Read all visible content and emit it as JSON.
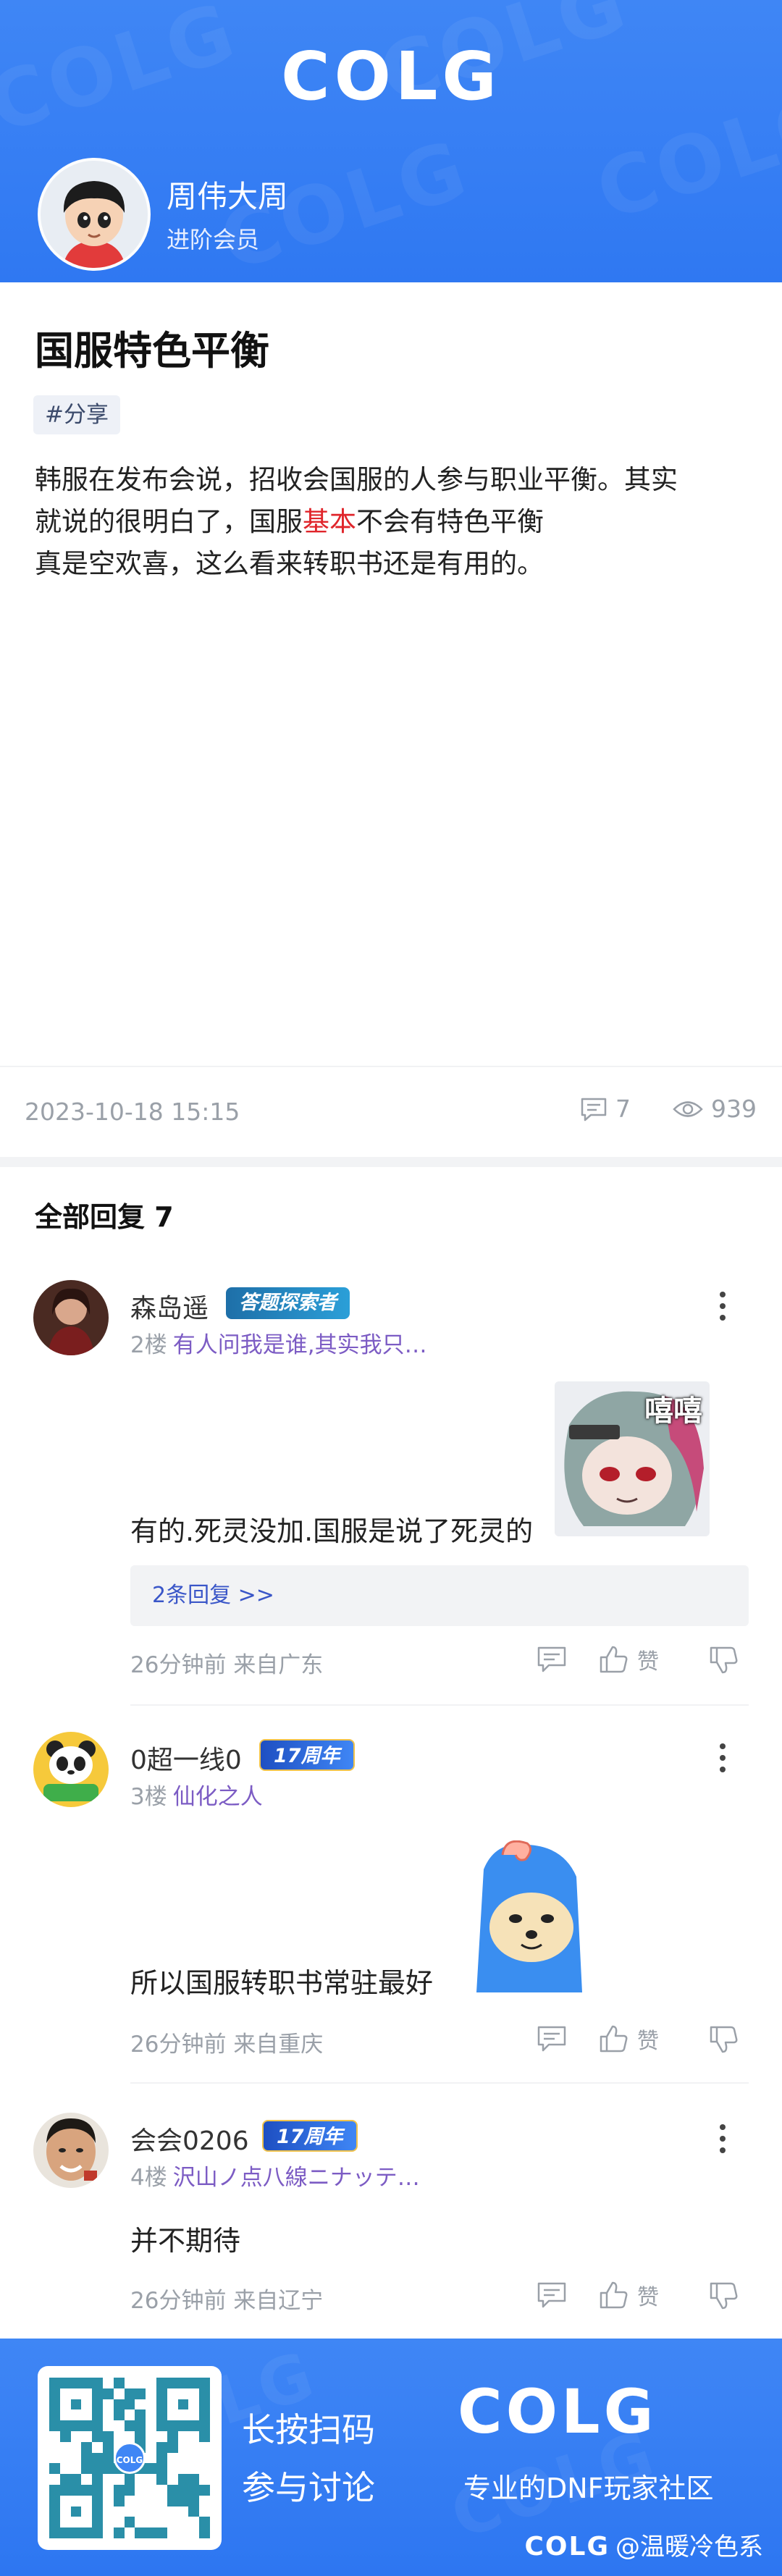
{
  "header": {
    "logo_text": "COLG",
    "username": "周伟大周",
    "user_level": "进阶会员"
  },
  "post": {
    "title": "国服特色平衡",
    "tag": "#分享",
    "body_line1": "韩服在发布会说，招收会国服的人参与职业平衡。其实",
    "body_line2_before": "就说的很明白了，国服",
    "body_line2_highlight": "基本",
    "body_line2_after": "不会有特色平衡",
    "body_line3": "真是空欢喜，这么看来转职书还是有用的。",
    "highlight_color": "#e0252b",
    "date": "2023-10-18 15:15",
    "comment_count": "7",
    "view_count": "939"
  },
  "replies": {
    "header": "全部回复 7",
    "items": [
      {
        "name": "森岛遥",
        "badge": "答题探索者",
        "floor": "2楼",
        "quote": "有人问我是谁,其实我只…",
        "text": "有的.死灵没加.国服是说了死灵的",
        "sticker_text": "嘻嘻",
        "sub_replies": "2条回复 >>",
        "time": "26分钟前",
        "location": "来自广东",
        "like_label": "赞"
      },
      {
        "name": "0超一线0",
        "badge": "17周年",
        "floor": "3楼",
        "quote": "仙化之人",
        "text": "所以国服转职书常驻最好",
        "time": "26分钟前",
        "location": "来自重庆",
        "like_label": "赞"
      },
      {
        "name": "会会0206",
        "badge": "17周年",
        "floor": "4楼",
        "quote": "沢山ノ点八線ニナッテ…",
        "text": "并不期待",
        "time": "26分钟前",
        "location": "来自辽宁",
        "like_label": "赞"
      }
    ]
  },
  "footer": {
    "qr_logo": "COLG",
    "cta_line1": "长按扫码",
    "cta_line2": "参与讨论",
    "logo_text": "COLG",
    "slogan": "专业的DNF玩家社区",
    "credit_logo": "COLG",
    "credit_text": "@温暖冷色系"
  },
  "colors": {
    "brand_blue": "#3f86f5",
    "quote_purple": "#7c5cc4",
    "link_blue": "#3a56c8",
    "meta_gray": "#9aa0a8"
  }
}
